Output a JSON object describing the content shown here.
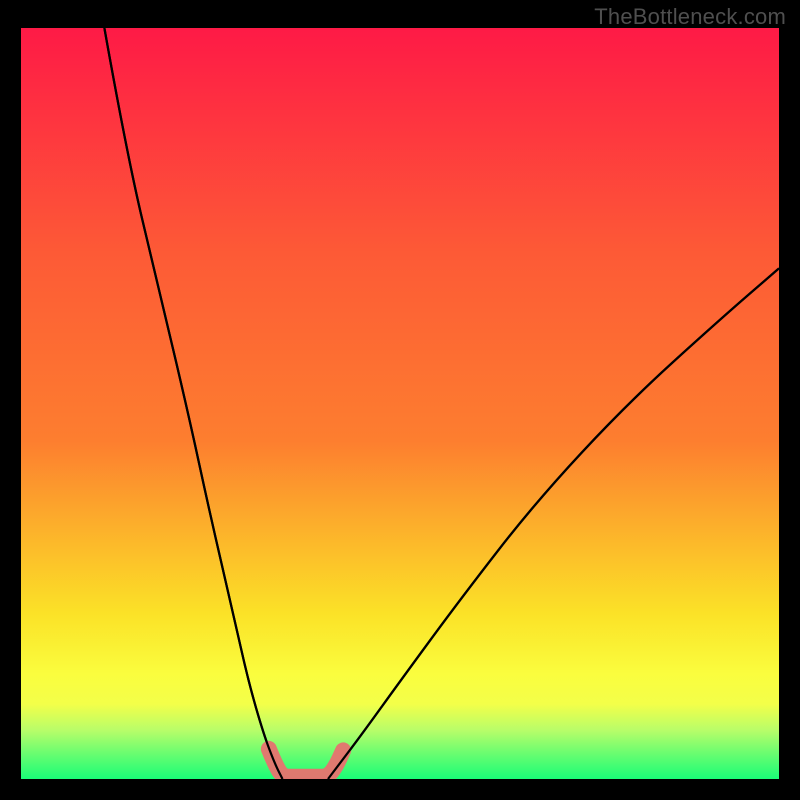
{
  "watermark": "TheBottleneck.com",
  "colors": {
    "gradient_top": "#fe1a46",
    "gradient_mid1": "#fd7e2f",
    "gradient_mid2": "#fbe227",
    "gradient_band_yellow": "#fafd3e",
    "gradient_band_lightgreen": "#b8fd69",
    "gradient_bottom": "#1afd77",
    "curve": "#000000",
    "blob": "#e2766f",
    "frame": "#000000"
  },
  "chart_data": {
    "type": "line",
    "title": "",
    "xlabel": "",
    "ylabel": "",
    "xlim": [
      0,
      100
    ],
    "ylim": [
      0,
      100
    ],
    "series": [
      {
        "name": "left-branch",
        "x": [
          11,
          14,
          18,
          22,
          25,
          28,
          30,
          32,
          33.5,
          34.5
        ],
        "y": [
          100,
          83,
          66,
          49,
          35,
          22,
          13,
          6,
          2,
          0
        ]
      },
      {
        "name": "right-branch",
        "x": [
          40.5,
          42,
          45,
          50,
          58,
          68,
          80,
          92,
          100
        ],
        "y": [
          0,
          2,
          6,
          13,
          24,
          37,
          50,
          61,
          68
        ]
      }
    ],
    "flat_bottom": {
      "x_start": 34.5,
      "x_end": 40.5,
      "y": 0
    },
    "markers": {
      "name": "pink-blobs",
      "points": [
        {
          "x": 32.7,
          "y": 4.0
        },
        {
          "x": 33.5,
          "y": 2.0
        },
        {
          "x": 34.5,
          "y": 0.3
        },
        {
          "x": 36.0,
          "y": 0.3
        },
        {
          "x": 37.5,
          "y": 0.3
        },
        {
          "x": 39.0,
          "y": 0.3
        },
        {
          "x": 40.5,
          "y": 0.3
        },
        {
          "x": 41.6,
          "y": 1.8
        },
        {
          "x": 42.5,
          "y": 3.8
        }
      ]
    }
  }
}
